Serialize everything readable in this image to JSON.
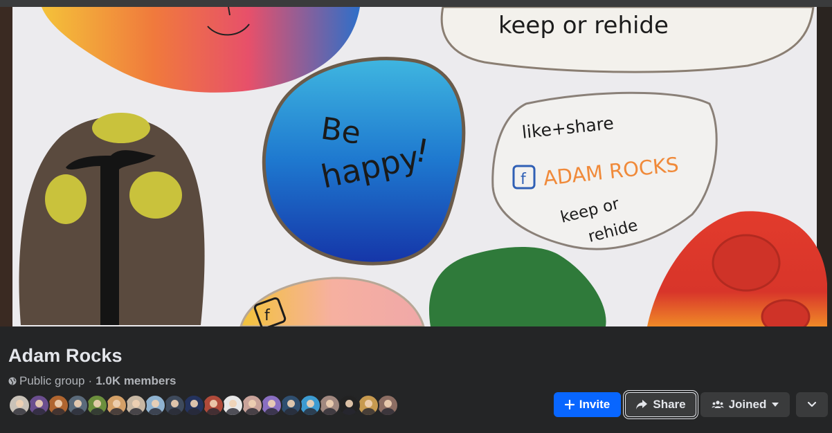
{
  "group": {
    "name": "Adam Rocks",
    "privacy": "Public group",
    "separator": "·",
    "members": "1.0K members"
  },
  "cover": {
    "rock_texts": {
      "top_right": "keep or rehide",
      "blue": [
        "Be",
        "happy",
        "!"
      ],
      "white_line1": "like+share",
      "white_brand": "ADAM ROCKS",
      "white_keep": "keep or",
      "white_rehide": "rehide",
      "small_f": "f"
    }
  },
  "avatars": [
    {
      "bg": "#c9c2b8"
    },
    {
      "bg": "#6b4e8f"
    },
    {
      "bg": "#b0652f"
    },
    {
      "bg": "#5a6a7a"
    },
    {
      "bg": "#6c8f3d"
    },
    {
      "bg": "#d4a067"
    },
    {
      "bg": "#c7b7a3"
    },
    {
      "bg": "#8fb3d1"
    },
    {
      "bg": "#3e4a5c"
    },
    {
      "bg": "#24335e"
    },
    {
      "bg": "#b04a3a"
    },
    {
      "bg": "#e8e8e8"
    },
    {
      "bg": "#c9a39a"
    },
    {
      "bg": "#8a6fc2"
    },
    {
      "bg": "#2f4f70"
    },
    {
      "bg": "#3c9bd1"
    },
    {
      "bg": "#a1887f"
    },
    {
      "bg": "#222222"
    },
    {
      "bg": "#c79a4f"
    },
    {
      "bg": "#8d6e63"
    }
  ],
  "actions": {
    "invite": "Invite",
    "share": "Share",
    "joined": "Joined"
  },
  "colors": {
    "primary": "#0866ff",
    "surface": "#242526",
    "button": "#3a3b3c",
    "text": "#e4e6eb",
    "secondary_text": "#b0b3b8"
  },
  "icons": {
    "invite": "plus-icon",
    "share": "share-arrow-icon",
    "joined": "members-icon",
    "more": "chevron-down-icon",
    "privacy": "globe-icon"
  }
}
